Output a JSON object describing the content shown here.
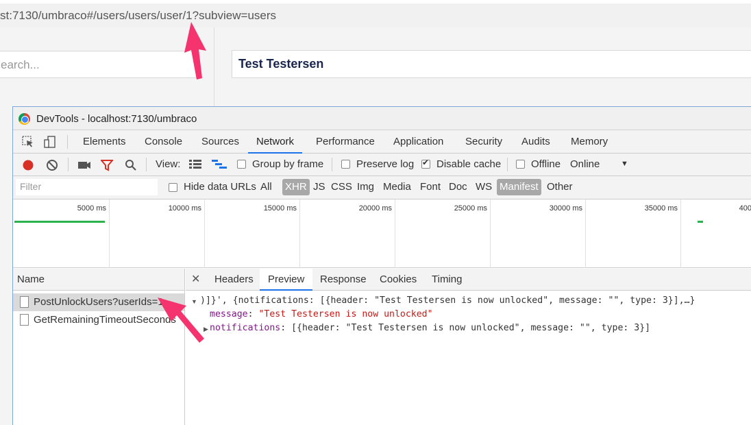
{
  "browser": {
    "url": "st:7130/umbraco#/users/users/user/1?subview=users"
  },
  "umbraco": {
    "search_placeholder": "earch...",
    "user_name": "Test Testersen"
  },
  "devtools": {
    "title": "DevTools - localhost:7130/umbraco",
    "tabs": [
      "Elements",
      "Console",
      "Sources",
      "Network",
      "Performance",
      "Application",
      "Security",
      "Audits",
      "Memory"
    ],
    "active_tab": "Network",
    "toolbar": {
      "view_label": "View:",
      "group_by_frame": "Group by frame",
      "preserve_log": "Preserve log",
      "disable_cache": "Disable cache",
      "offline": "Offline",
      "throttle": "Online",
      "group_by_frame_checked": false,
      "preserve_log_checked": false,
      "disable_cache_checked": true,
      "offline_checked": false
    },
    "filter": {
      "placeholder": "Filter",
      "hide_data_urls": "Hide data URLs",
      "types": [
        "All",
        "XHR",
        "JS",
        "CSS",
        "Img",
        "Media",
        "Font",
        "Doc",
        "WS",
        "Manifest",
        "Other"
      ],
      "selected_types": [
        "XHR",
        "Manifest"
      ]
    },
    "timeline": {
      "ticks": [
        "5000 ms",
        "10000 ms",
        "15000 ms",
        "20000 ms",
        "25000 ms",
        "30000 ms",
        "35000 ms",
        "400"
      ]
    },
    "requests": {
      "header": "Name",
      "items": [
        "PostUnlockUsers?userIds=1",
        "GetRemainingTimeoutSeconds"
      ]
    },
    "detail": {
      "tabs": [
        "Headers",
        "Preview",
        "Response",
        "Cookies",
        "Timing"
      ],
      "active_tab": "Preview",
      "line1": ")]}', {notifications: [{header: \"Test Testersen is now unlocked\", message: \"\", type: 3}],…}",
      "message_key": "message",
      "message_value": "\"Test Testersen is now unlocked\"",
      "notifications_key": "notifications",
      "notifications_value": "[{header: \"Test Testersen is now unlocked\", message: \"\", type: 3}]"
    }
  },
  "colors": {
    "accent": "#1a73e8",
    "annotation_arrow": "#f5336e",
    "record_red": "#d93025"
  }
}
